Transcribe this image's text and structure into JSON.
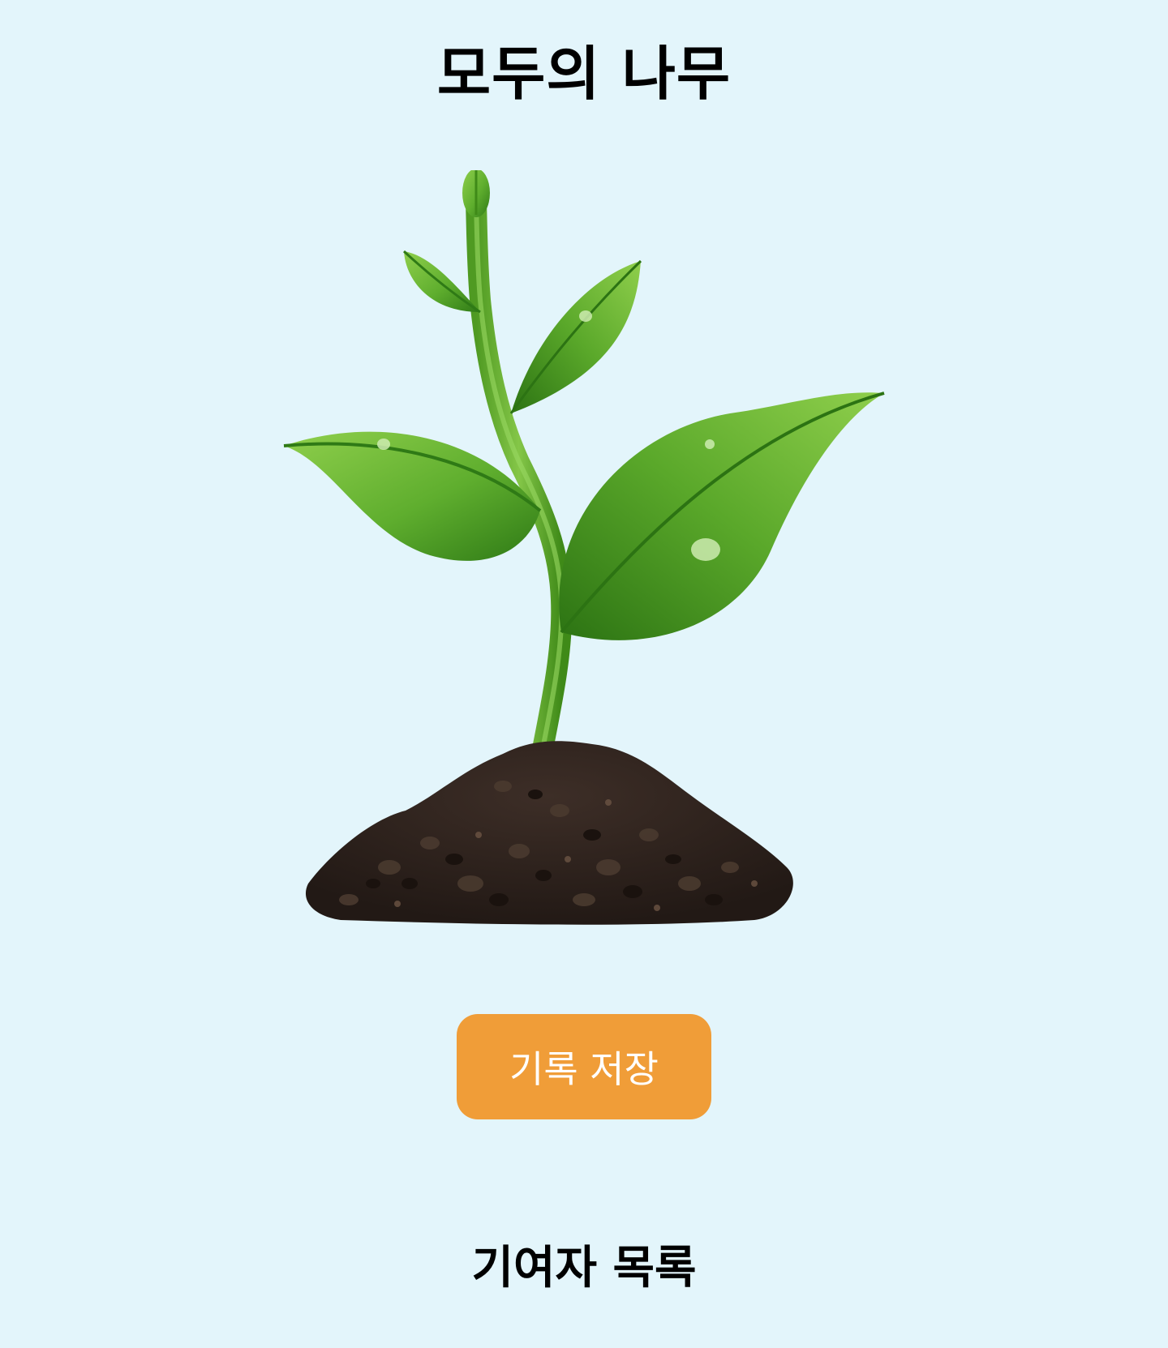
{
  "page": {
    "title": "모두의 나무",
    "background_color": "#e3f5fb"
  },
  "tree": {
    "image": "seedling-in-soil-icon",
    "leaf_color": "#5fae2e",
    "soil_color": "#2e221c"
  },
  "actions": {
    "save_record_label": "기록 저장",
    "save_button_color": "#f09d38"
  },
  "contributors": {
    "heading": "기여자 목록"
  }
}
